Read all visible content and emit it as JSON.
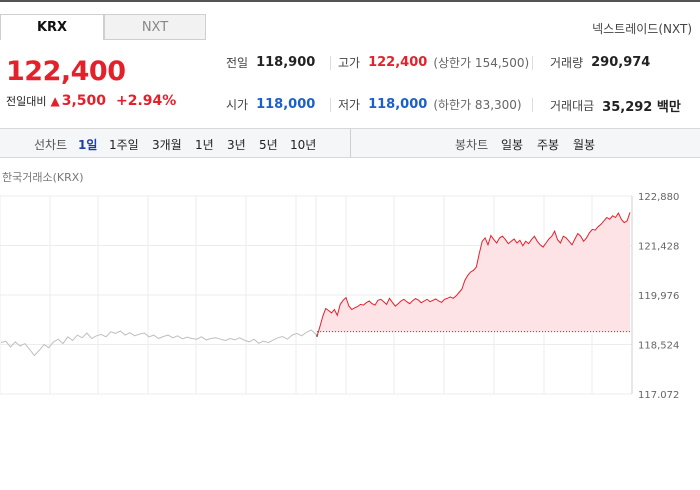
{
  "tabs": [
    {
      "label": "KRX",
      "active": true
    },
    {
      "label": "NXT",
      "active": false
    }
  ],
  "nxt_link": "넥스트레이드(NXT)",
  "price": {
    "current": "122,400",
    "change_label": "전일대비",
    "change_arrow": "▲",
    "change_value": "3,500",
    "change_pct": "+2.94%"
  },
  "stats": {
    "prev_close": {
      "label": "전일",
      "value": "118,900"
    },
    "high": {
      "label": "고가",
      "value": "122,400",
      "limit": "(상한가 154,500)"
    },
    "volume": {
      "label": "거래량",
      "value": "290,974"
    },
    "open": {
      "label": "시가",
      "value": "118,000"
    },
    "low": {
      "label": "저가",
      "value": "118,000",
      "limit": "(하한가 83,300)"
    },
    "trade_value": {
      "label": "거래대금",
      "value": "35,292 백만"
    }
  },
  "period_bar": {
    "line_label": "선차트",
    "line_periods": [
      "1일",
      "1주일",
      "3개월",
      "1년",
      "3년",
      "5년",
      "10년"
    ],
    "selected": "1일",
    "candle_label": "봉차트",
    "candle_periods": [
      "일봉",
      "주봉",
      "월봉"
    ]
  },
  "exchange_label": "한국거래소(KRX)",
  "colors": {
    "up": "#e4212b",
    "down": "#1a5fcc",
    "previous_day_line": "#bfbfbf",
    "area_fill": "#fde3e5"
  },
  "chart_data": {
    "type": "area",
    "title": "",
    "xlabel": "",
    "ylabel": "",
    "ylim": [
      117072,
      122880
    ],
    "yticks": [
      "122,880",
      "121,428",
      "119,976",
      "118,524",
      "117,072"
    ],
    "baseline": 118900,
    "grid": true,
    "series": [
      {
        "values": [
          118580,
          118620,
          118450,
          118600,
          118480,
          118550,
          118380,
          118200,
          118350,
          118520,
          118430,
          118600,
          118680,
          118550,
          118750,
          118640,
          118800,
          118720,
          118860,
          118700,
          118780,
          118820,
          118750,
          118900,
          118850,
          118920,
          118800,
          118870,
          118780,
          118830,
          118860,
          118750,
          118800,
          118700,
          118760,
          118800,
          118720,
          118780,
          118690,
          118740,
          118700,
          118680,
          118750,
          118660,
          118700,
          118720,
          118680,
          118640,
          118700,
          118660,
          118720,
          118650,
          118600,
          118680,
          118560,
          118620,
          118580,
          118650,
          118720,
          118760,
          118680,
          118800,
          118850,
          118780,
          118880,
          118950,
          118820
        ]
      },
      {
        "values": [
          118750,
          119050,
          119350,
          119580,
          119520,
          119450,
          119550,
          119380,
          119700,
          119820,
          119900,
          119650,
          119550,
          119600,
          119640,
          119700,
          119680,
          119750,
          119800,
          119720,
          119680,
          119820,
          119850,
          119780,
          119700,
          119880,
          119760,
          119650,
          119720,
          119800,
          119850,
          119780,
          119720,
          119810,
          119870,
          119830,
          119750,
          119800,
          119850,
          119780,
          119820,
          119860,
          119800,
          119760,
          119850,
          119880,
          119920,
          119880,
          119950,
          120050,
          120150,
          120400,
          120550,
          120650,
          120700,
          120800,
          121200,
          121550,
          121650,
          121450,
          121720,
          121600,
          121500,
          121650,
          121700,
          121600,
          121480,
          121550,
          121620,
          121500,
          121580,
          121420,
          121550,
          121480,
          121600,
          121700,
          121550,
          121450,
          121380,
          121500,
          121620,
          121700,
          121850,
          121600,
          121500,
          121700,
          121650,
          121550,
          121450,
          121620,
          121780,
          121700,
          121550,
          121650,
          121800,
          121900,
          121880,
          121980,
          122050,
          122150,
          122250,
          122200,
          122300,
          122250,
          122380,
          122200,
          122100,
          122150,
          122400
        ]
      }
    ]
  }
}
